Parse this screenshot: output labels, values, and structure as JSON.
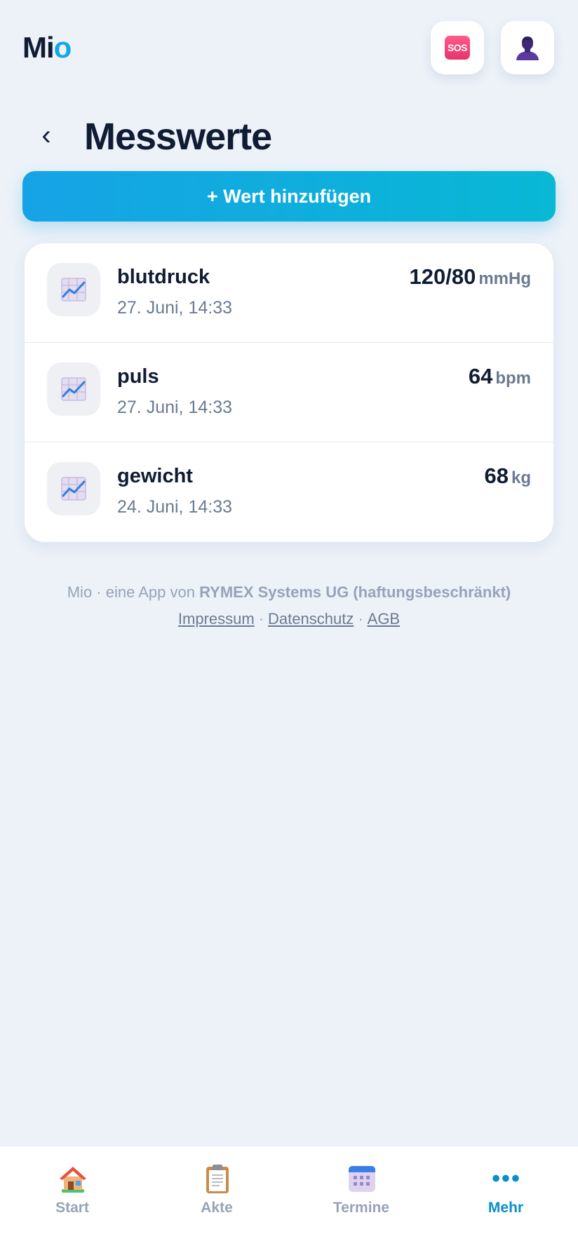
{
  "header": {
    "logo_main": "Mi",
    "logo_accent": "o",
    "sos_label": "SOS",
    "profile_icon": "person-icon"
  },
  "page": {
    "title": "Messwerte",
    "back_icon": "chevron-left-icon",
    "add_button_label": "+ Wert hinzufügen"
  },
  "measurements": [
    {
      "name": "blutdruck",
      "date": "27. Juni, 14:33",
      "value": "120/80",
      "unit": "mmHg",
      "icon": "chart-icon"
    },
    {
      "name": "puls",
      "date": "27. Juni, 14:33",
      "value": "64",
      "unit": "bpm",
      "icon": "chart-icon"
    },
    {
      "name": "gewicht",
      "date": "24. Juni, 14:33",
      "value": "68",
      "unit": "kg",
      "icon": "chart-icon"
    }
  ],
  "footer": {
    "prefix": "Mio · eine App von ",
    "company": "RYMEX Systems UG (haftungsbeschränkt)",
    "links": [
      "Impressum",
      "Datenschutz",
      "AGB"
    ],
    "separator": "·"
  },
  "nav": {
    "items": [
      {
        "label": "Start",
        "icon": "house-icon",
        "active": false
      },
      {
        "label": "Akte",
        "icon": "clipboard-icon",
        "active": false
      },
      {
        "label": "Termine",
        "icon": "calendar-icon",
        "active": false
      },
      {
        "label": "Mehr",
        "icon": "more-dots-icon",
        "active": true
      }
    ],
    "more_glyph": "•••"
  },
  "colors": {
    "background": "#edf2f9",
    "accent": "#16a6e6",
    "active_nav": "#0a8fc7",
    "sos": "#e8336d",
    "text_primary": "#0f1c33",
    "text_muted": "#6b7a92"
  }
}
